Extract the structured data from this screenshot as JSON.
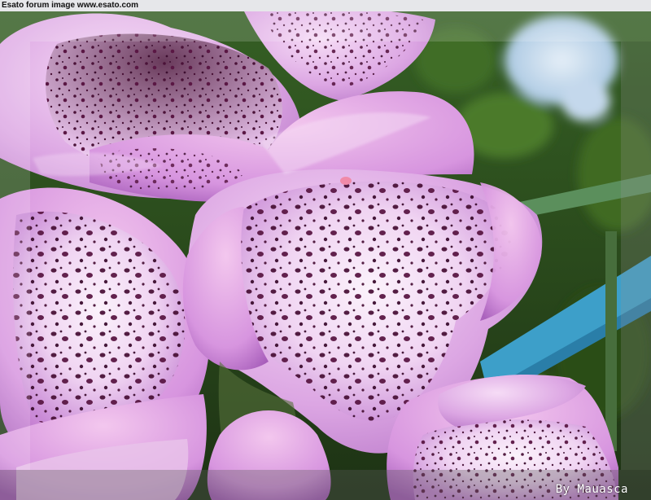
{
  "watermark": {
    "text": "Esato forum image www.esato.com"
  },
  "credit": {
    "text": "By Mauasca"
  },
  "colors": {
    "petal_light": "#f2d6f3",
    "petal_mid": "#d79ee0",
    "petal_deep": "#b06cc4",
    "spot": "#4a1238",
    "foliage": "#2f5a1c",
    "sky": "#c9dcef",
    "rail": "#3d9fc9"
  }
}
